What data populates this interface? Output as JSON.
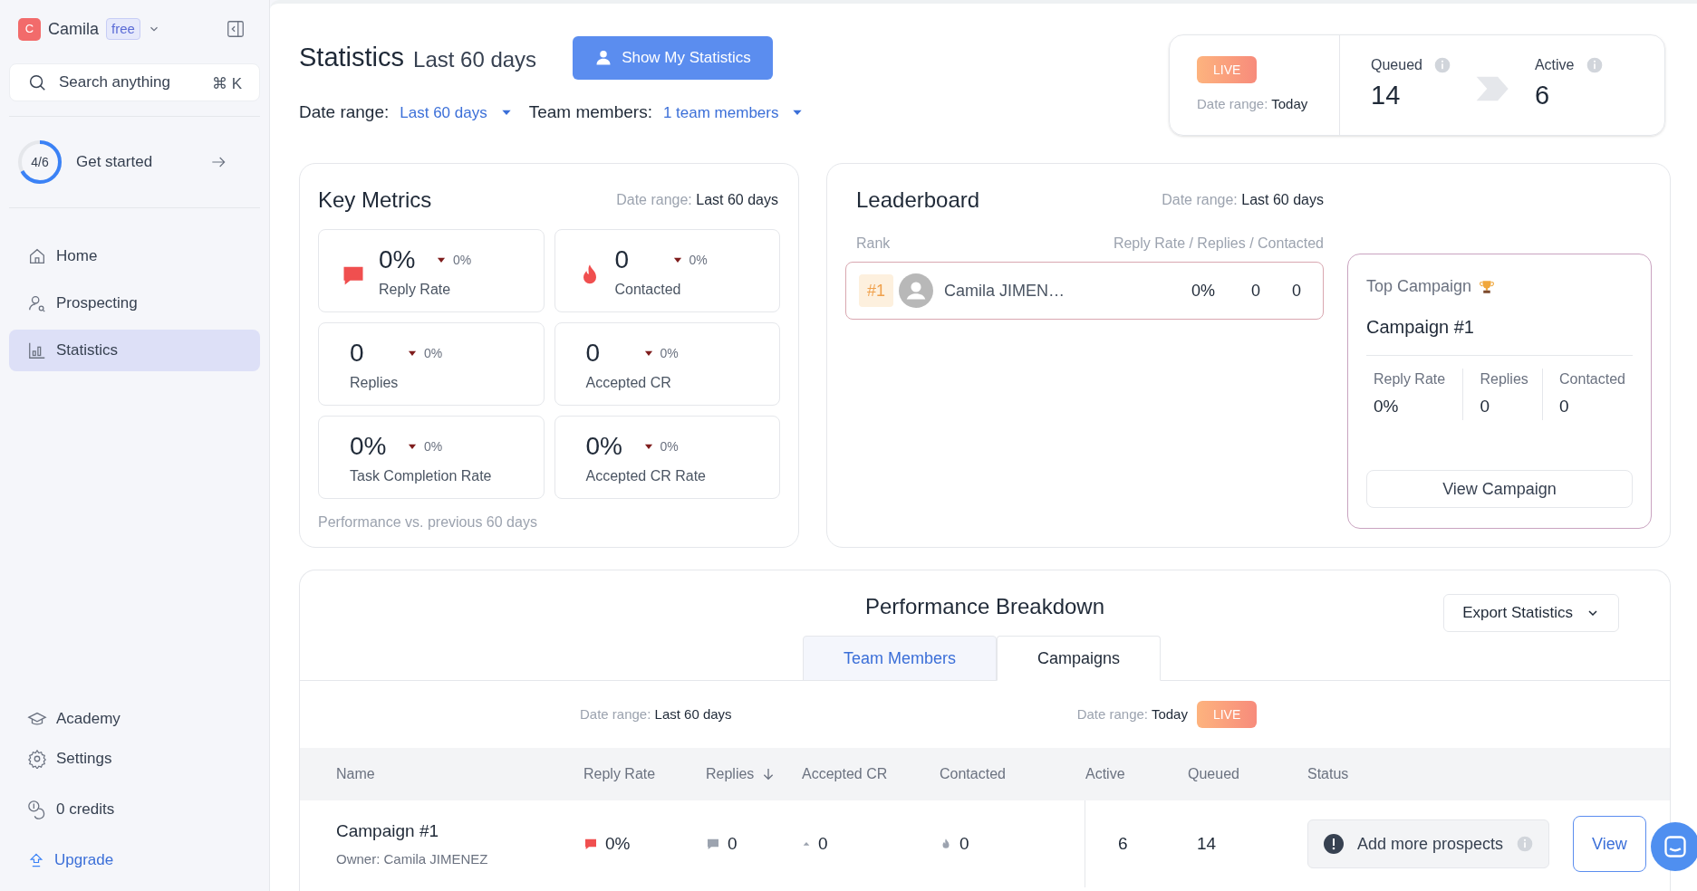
{
  "sidebar": {
    "user": {
      "initial": "C",
      "name": "Camila",
      "plan": "free"
    },
    "search": {
      "placeholder": "Search anything",
      "shortcut": "⌘ K"
    },
    "onboarding": {
      "progress": "4/6",
      "level": 0.67,
      "label": "Get started"
    },
    "nav": [
      {
        "label": "Home",
        "selected": false
      },
      {
        "label": "Prospecting",
        "selected": false
      },
      {
        "label": "Statistics",
        "selected": true
      }
    ],
    "bottom": [
      {
        "label": "Academy"
      },
      {
        "label": "Settings"
      },
      {
        "label": "0 credits"
      }
    ],
    "upgrade": "Upgrade"
  },
  "header": {
    "title": "Statistics",
    "subtitle": "Last 60 days",
    "button": "Show My Statistics",
    "filters": [
      {
        "label": "Date range:",
        "value": "Last 60 days"
      },
      {
        "label": "Team members:",
        "value": "1 team members"
      }
    ]
  },
  "live_panel": {
    "badge": "LIVE",
    "date_label": "Date range:",
    "date_value": "Today",
    "queued": {
      "label": "Queued",
      "value": "14"
    },
    "active": {
      "label": "Active",
      "value": "6"
    }
  },
  "key_metrics": {
    "title": "Key Metrics",
    "date_label": "Date range:",
    "date_value": "Last 60 days",
    "metrics": [
      {
        "value": "0%",
        "change": "0%",
        "label": "Reply Rate"
      },
      {
        "value": "0",
        "change": "0%",
        "label": "Contacted"
      },
      {
        "value": "0",
        "change": "0%",
        "label": "Replies"
      },
      {
        "value": "0",
        "change": "0%",
        "label": "Accepted CR"
      },
      {
        "value": "0%",
        "change": "0%",
        "label": "Task Completion Rate"
      },
      {
        "value": "0%",
        "change": "0%",
        "label": "Accepted CR Rate"
      }
    ],
    "footnote": "Performance vs. previous 60 days"
  },
  "leaderboard": {
    "title": "Leaderboard",
    "date_label": "Date range:",
    "date_value": "Last 60 days",
    "columns": [
      "Rank",
      "Reply Rate / Replies / Contacted"
    ],
    "rows": [
      {
        "rank": "#1",
        "name": "Camila JIMEN…",
        "reply_rate": "0%",
        "replies": "0",
        "contacted": "0"
      }
    ]
  },
  "top_campaign": {
    "title": "Top Campaign",
    "name": "Campaign #1",
    "stats": [
      {
        "label": "Reply Rate",
        "value": "0%"
      },
      {
        "label": "Replies",
        "value": "0"
      },
      {
        "label": "Contacted",
        "value": "0"
      }
    ],
    "button": "View Campaign"
  },
  "breakdown": {
    "title": "Performance Breakdown",
    "export": "Export Statistics",
    "tabs": [
      {
        "label": "Team Members",
        "selected": false
      },
      {
        "label": "Campaigns",
        "selected": true
      }
    ],
    "range_left": {
      "label": "Date range:",
      "value": "Last 60 days"
    },
    "range_right": {
      "label": "Date range:",
      "value": "Today",
      "badge": "LIVE"
    },
    "columns": [
      {
        "label": "Name",
        "sorted": false
      },
      {
        "label": "Reply Rate",
        "sorted": false
      },
      {
        "label": "Replies",
        "sorted": true
      },
      {
        "label": "Accepted CR",
        "sorted": false
      },
      {
        "label": "Contacted",
        "sorted": false
      },
      {
        "label": "Active",
        "sorted": false
      },
      {
        "label": "Queued",
        "sorted": false
      },
      {
        "label": "Status",
        "sorted": false
      }
    ],
    "rows": [
      {
        "name": "Campaign #1",
        "owner": "Owner: Camila JIMENEZ",
        "reply_rate": "0%",
        "replies": "0",
        "accepted_cr": "0",
        "contacted": "0",
        "active": "6",
        "queued": "14",
        "status": "Add more prospects",
        "action": "View"
      }
    ]
  }
}
